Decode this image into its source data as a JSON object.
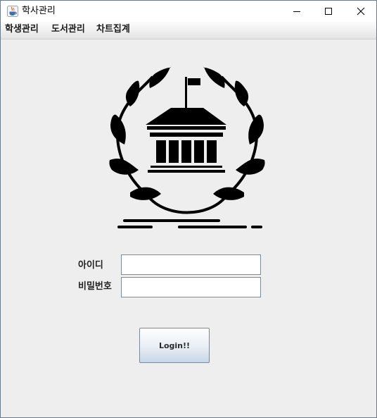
{
  "window": {
    "title": "학사관리"
  },
  "menu": {
    "items": [
      "학생관리",
      "도서관리",
      "차트집계"
    ]
  },
  "form": {
    "id_label": "아이디",
    "id_value": "",
    "password_label": "비밀번호",
    "password_value": "",
    "login_label": "Login!!"
  },
  "icons": {
    "app": "java-coffee-icon",
    "emblem": "university-laurel-emblem",
    "minimize": "minimize-icon",
    "maximize": "maximize-icon",
    "close": "close-icon"
  }
}
